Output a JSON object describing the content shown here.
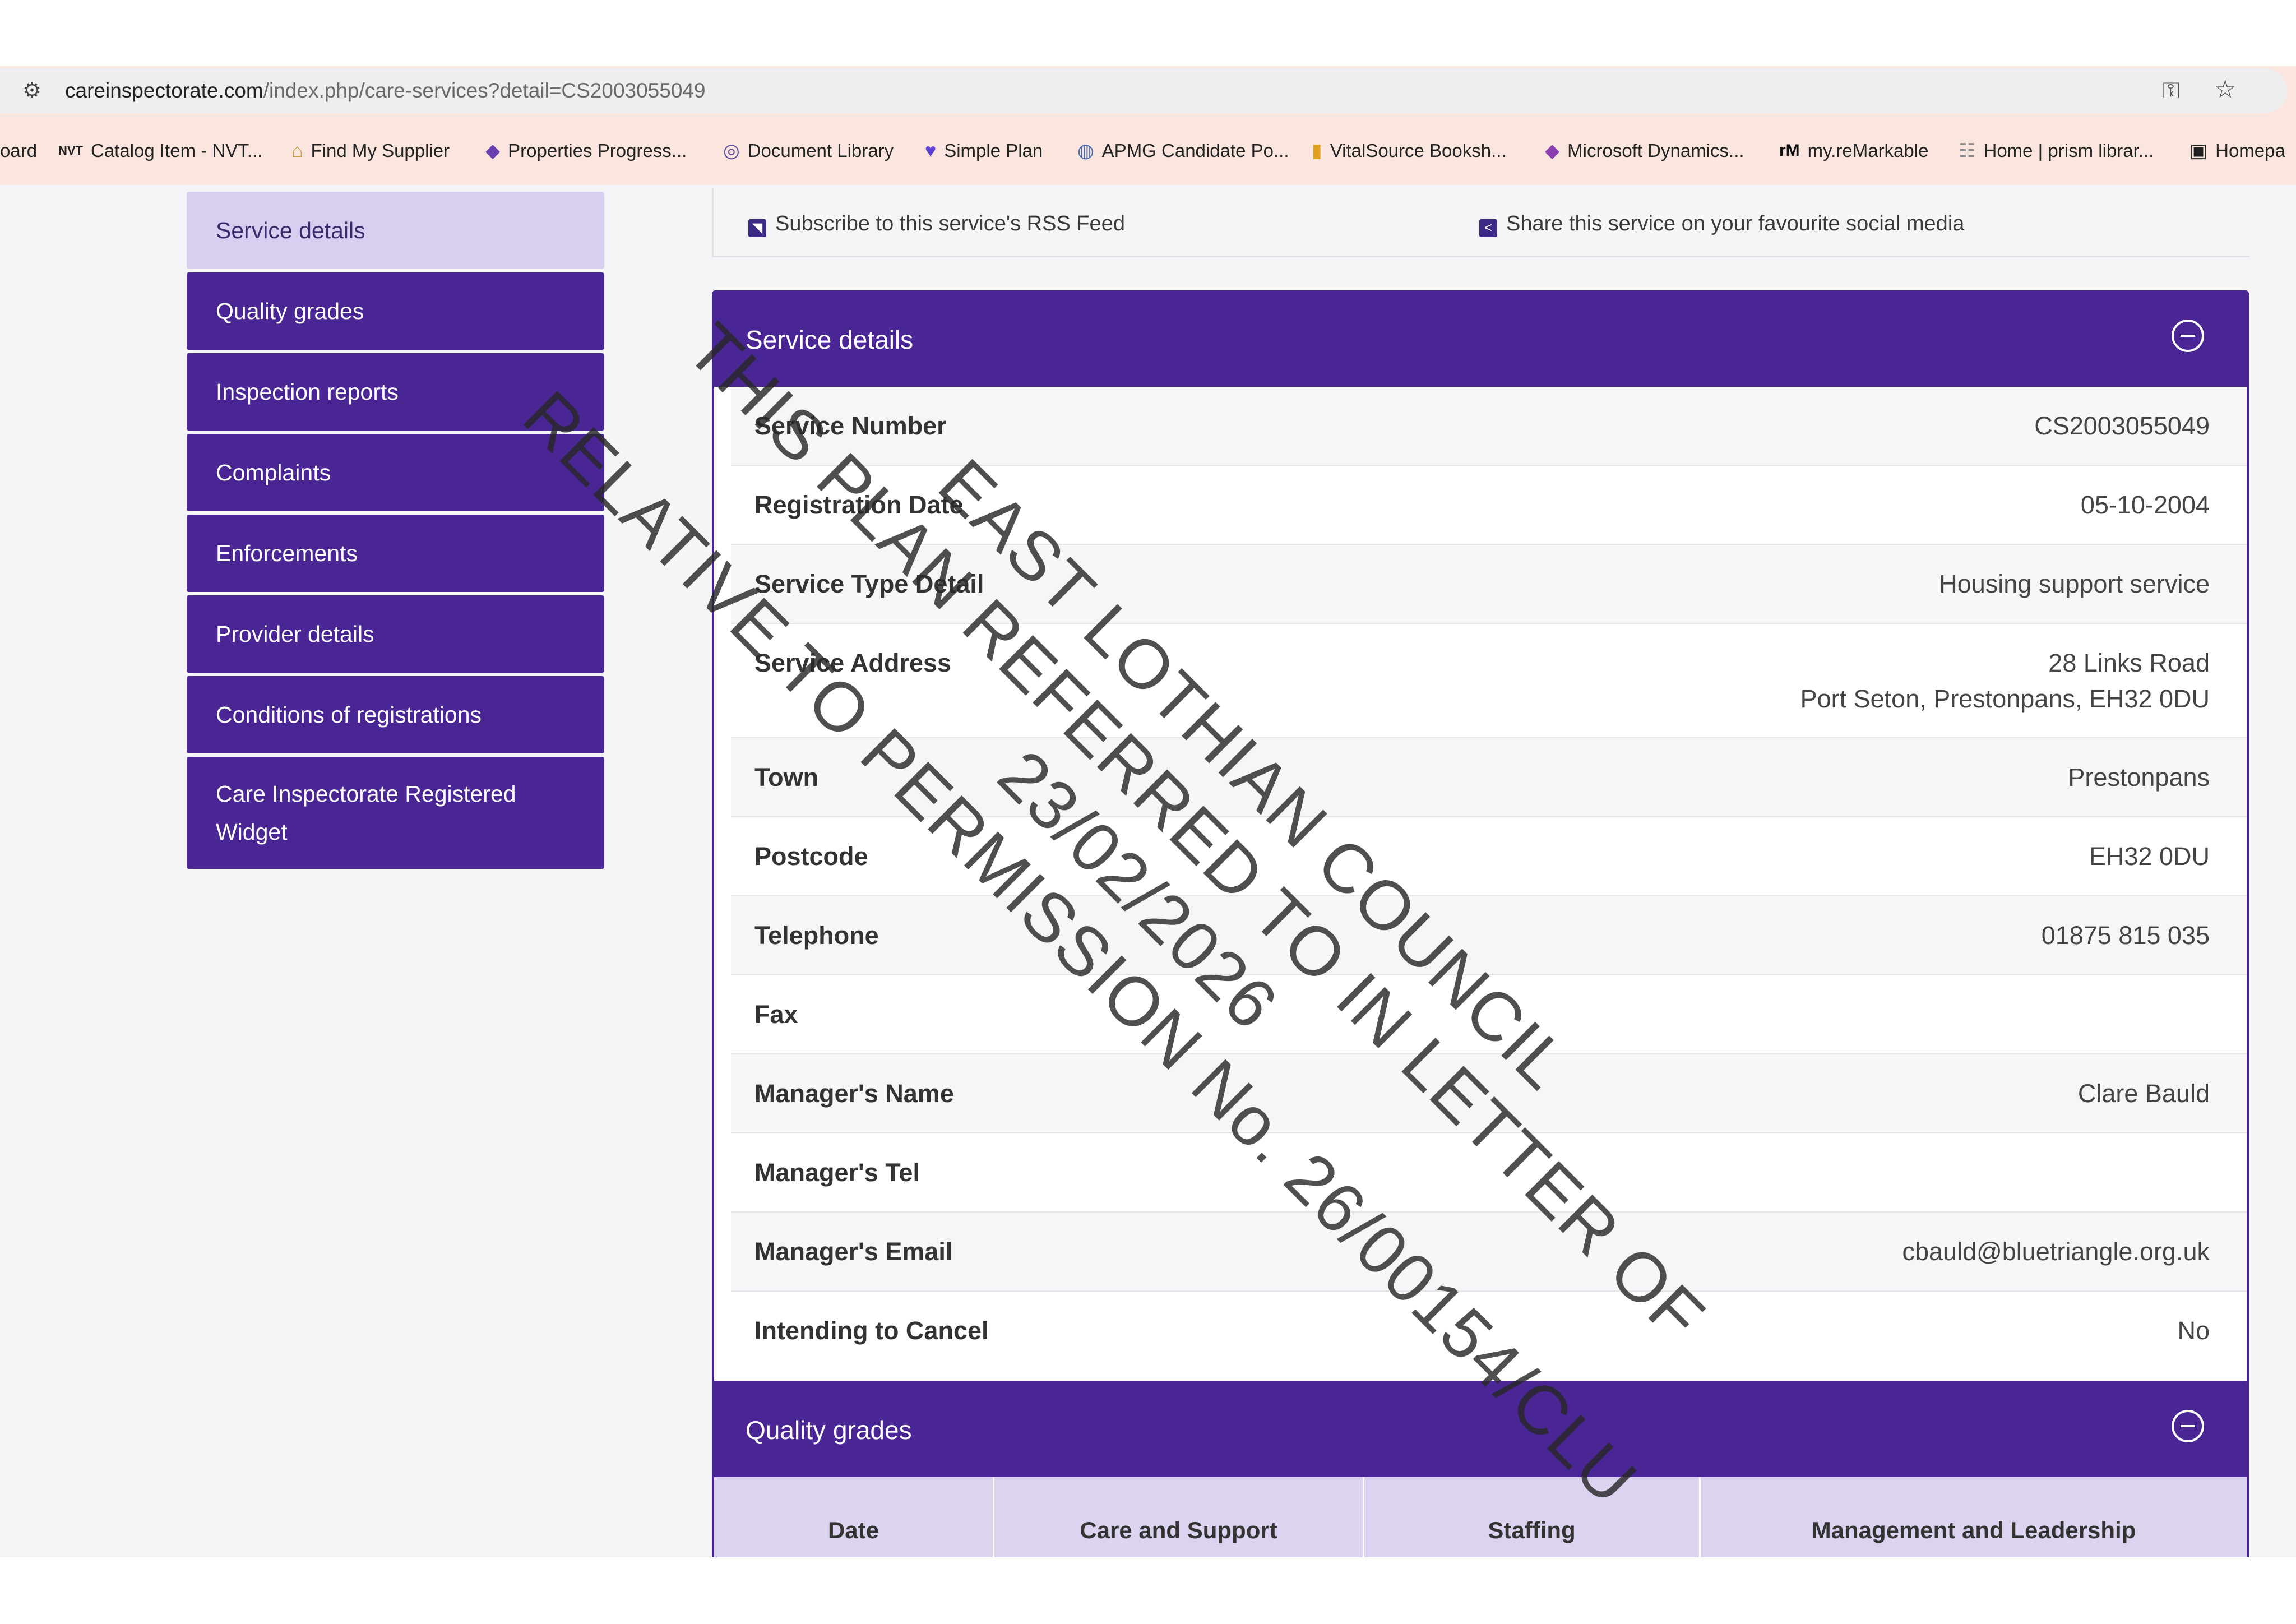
{
  "browser": {
    "url_domain": "careinspectorate.com",
    "url_path": "/index.php/care-services?detail=CS2003055049",
    "bookmarks": [
      {
        "label": "oard",
        "icon": ""
      },
      {
        "label": "Catalog Item - NVT...",
        "icon": "nvt-icon"
      },
      {
        "label": "Find My Supplier",
        "icon": "supplier-icon"
      },
      {
        "label": "Properties Progress...",
        "icon": "power-apps-icon"
      },
      {
        "label": "Document Library",
        "icon": "library-icon"
      },
      {
        "label": "Simple Plan",
        "icon": "heart-icon"
      },
      {
        "label": "APMG Candidate Po...",
        "icon": "apmg-icon"
      },
      {
        "label": "VitalSource Booksh...",
        "icon": "vitalsource-icon"
      },
      {
        "label": "Microsoft Dynamics...",
        "icon": "dynamics-icon"
      },
      {
        "label": "my.reMarkable",
        "icon": "remarkable-icon"
      },
      {
        "label": "Home | prism librar...",
        "icon": "prism-icon"
      },
      {
        "label": "Homepa",
        "icon": "homepage-icon"
      }
    ]
  },
  "sidebar": {
    "items": [
      {
        "label": "Service details",
        "active": true
      },
      {
        "label": "Quality grades"
      },
      {
        "label": "Inspection reports"
      },
      {
        "label": "Complaints"
      },
      {
        "label": "Enforcements"
      },
      {
        "label": "Provider details"
      },
      {
        "label": "Conditions of registrations"
      },
      {
        "label_line1": "Care Inspectorate Registered",
        "label_line2": "Widget"
      }
    ]
  },
  "toplinks": {
    "rss": "Subscribe to this service's RSS Feed",
    "share": "Share this service on your favourite social media"
  },
  "service_details": {
    "title": "Service details",
    "rows": [
      {
        "label": "Service Number",
        "value": "CS2003055049"
      },
      {
        "label": "Registration Date",
        "value": "05-10-2004"
      },
      {
        "label": "Service Type Detail",
        "value": "Housing support service"
      },
      {
        "label": "Service Address",
        "value_line1": "28 Links Road",
        "value_line2": "Port Seton, Prestonpans, EH32 0DU"
      },
      {
        "label": "Town",
        "value": "Prestonpans"
      },
      {
        "label": "Postcode",
        "value": "EH32 0DU"
      },
      {
        "label": "Telephone",
        "value": "01875 815 035"
      },
      {
        "label": "Fax",
        "value": ""
      },
      {
        "label": "Manager's Name",
        "value": "Clare Bauld"
      },
      {
        "label": "Manager's Tel",
        "value": ""
      },
      {
        "label": "Manager's Email",
        "value": "cbauld@bluetriangle.org.uk"
      },
      {
        "label": "Intending to Cancel",
        "value": "No"
      }
    ]
  },
  "quality_grades": {
    "title": "Quality grades",
    "columns": [
      "Date",
      "Care and Support",
      "Staffing",
      "Management and Leadership"
    ]
  },
  "stamp": {
    "line1": "EAST LOTHIAN COUNCIL",
    "line2": "THIS PLAN REFERRED TO IN LETTER OF",
    "line3": "23/02/2026",
    "line4": "RELATIVE TO PERMISSION No. 26/00154/CLU"
  }
}
